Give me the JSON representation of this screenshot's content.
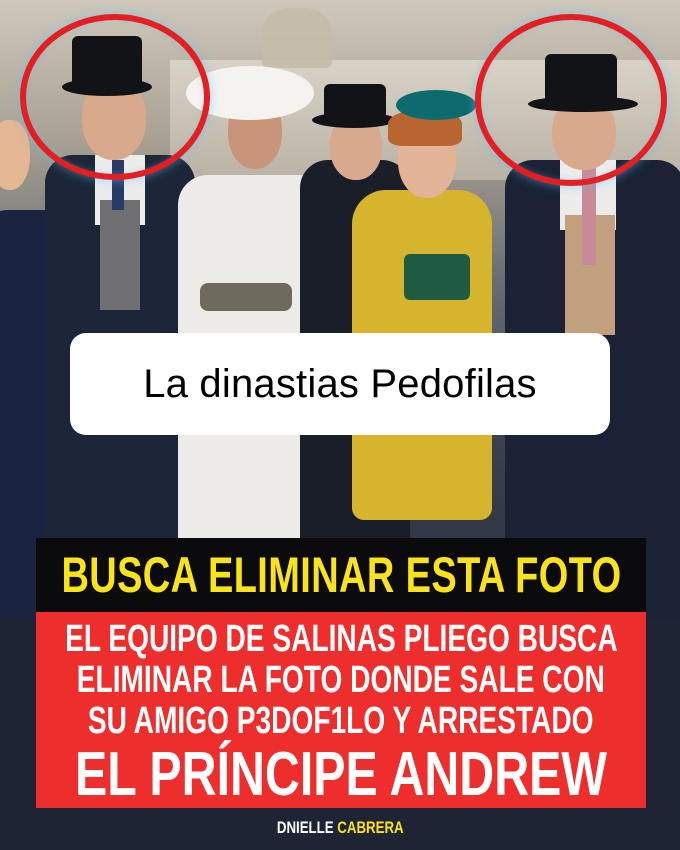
{
  "title_card": {
    "text": "La dinastias Pedofilas"
  },
  "headline": {
    "text": "BUSCA ELIMINAR ESTA FOTO"
  },
  "body_lines": [
    "EL EQUIPO DE SALINAS PLIEGO BUSCA",
    "ELIMINAR LA FOTO DONDE SALE CON",
    "SU AMIGO P3DOF1LO Y ARRESTADO"
  ],
  "highlight": {
    "text": "EL PRÍNCIPE ANDREW"
  },
  "credit": {
    "first": "DNIELLE",
    "last": "CABRERA"
  },
  "colors": {
    "headline_bg": "#0b0b0d",
    "headline_text": "#fbe319",
    "body_bg": "#ee2e2c",
    "circle_outline": "#e41f23"
  }
}
